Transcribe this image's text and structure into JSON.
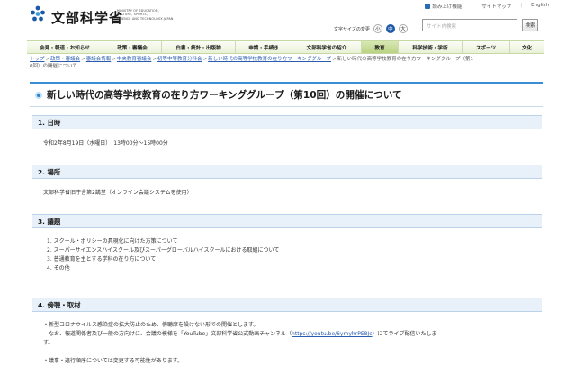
{
  "header": {
    "logo_text": "文部科学省",
    "logo_sub_lines": [
      "MINISTRY OF EDUCATION,",
      "CULTURE, SPORTS,",
      "SCIENCE AND TECHNOLOGY-JAPAN"
    ],
    "util_links": [
      "読み上げ機能",
      "サイトマップ",
      "English"
    ],
    "fontsize_label": "文字サイズの変更",
    "fontsize_options": [
      "小",
      "中",
      "大"
    ],
    "fontsize_selected": "中",
    "search_placeholder": "サイト内検索",
    "search_button": "検索",
    "accent_color": "#3a8ed6"
  },
  "gnav": {
    "items": [
      "会見・報道・お知らせ",
      "政策・審議会",
      "白書・統計・出版物",
      "申請・手続き",
      "文部科学省の紹介",
      "教育",
      "科学技術・学術",
      "スポーツ",
      "文化"
    ],
    "active_index": 5
  },
  "breadcrumb": {
    "links": [
      "トップ",
      "政策・審議会",
      "審議会情報",
      "中央教育審議会",
      "初等中等教育分科会",
      "新しい時代の高等学校教育の在り方ワーキンググループ"
    ],
    "current_line1": "新しい時代の高等学校教育の在り方ワーキンググループ（第1",
    "current_line2": "0回）の開催について",
    "separator": ">"
  },
  "page_title": "新しい時代の高等学校教育の在り方ワーキンググループ（第10回）の開催について",
  "sections": {
    "datetime": {
      "heading": "1. 日時",
      "body": "令和2年8月19日（水曜日）　13時00分～15時00分"
    },
    "place": {
      "heading": "2. 場所",
      "body": "文部科学省旧庁舎第2講堂（オンライン会議システムを使用）"
    },
    "agenda": {
      "heading": "3. 議題",
      "items": [
        "1. スクール・ポリシーの具現化に向けた方策について",
        "2. スーパーサイエンスハイスクール及びスーパーグローバルハイスクールにおける取組について",
        "3. 普通教育を主とする学科の在り方について",
        "4. その他"
      ]
    },
    "observe": {
      "heading": "4. 傍聴・取材",
      "line1": "・新型コロナウイルス感染症の拡大防止のため、傍聴席を設けない形での開催とします。",
      "line2_pre": "なお、報道関係者及び一般の方向けに、会議の模様を「YouTube」文部科学省公式動画チャンネル（",
      "line2_link": "https://youtu.be/6ymyhrPE8Jc",
      "line2_post": "）にてライブ配信いたしま",
      "line3": "す。",
      "line4": "・議事・進行順序については変更する可能性があります。"
    }
  }
}
